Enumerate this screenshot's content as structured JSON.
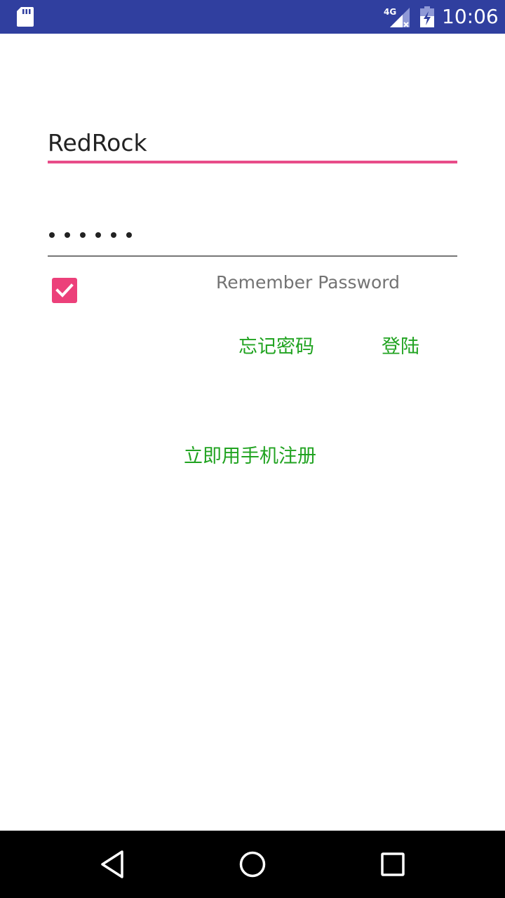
{
  "status_bar": {
    "time": "10:06",
    "network": "4G",
    "icons": [
      "sd-card-icon",
      "signal-4g-icon",
      "battery-charging-icon"
    ],
    "background": "#303f9f"
  },
  "login_form": {
    "username_value": "RedRock",
    "password_masked": "••••••",
    "password_length": 6,
    "remember_checked": true,
    "remember_label": "Remember Password",
    "forgot_label": "忘记密码",
    "login_label": "登陆",
    "register_label": "立即用手机注册"
  },
  "colors": {
    "accent": "#e84c89",
    "checkbox": "#ec407a",
    "link": "#21a321"
  },
  "nav_bar": {
    "icons": [
      "back-icon",
      "home-icon",
      "recents-icon"
    ]
  }
}
